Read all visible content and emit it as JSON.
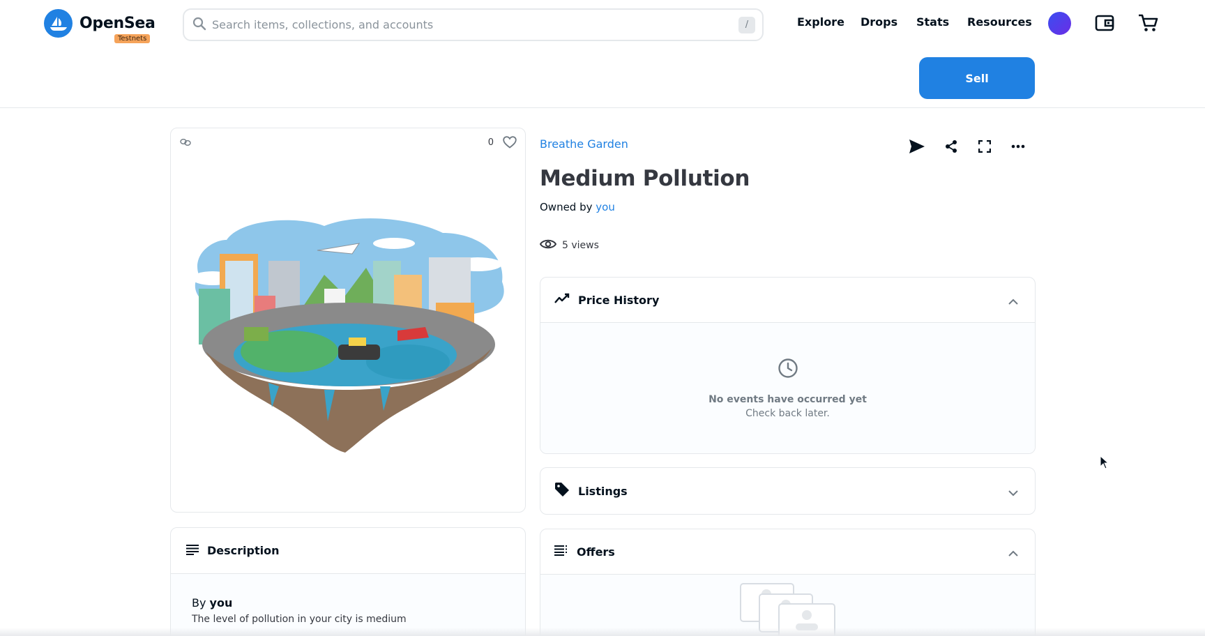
{
  "header": {
    "logo_text": "OpenSea",
    "badge": "Testnets",
    "search_placeholder": "Search items, collections, and accounts",
    "search_shortcut": "/",
    "nav": [
      "Explore",
      "Drops",
      "Stats",
      "Resources"
    ],
    "sell_label": "Sell"
  },
  "item": {
    "collection": "Breathe Garden",
    "title": "Medium Pollution",
    "owned_prefix": "Owned by",
    "owner": "you",
    "views": "5 views",
    "favorites": "0"
  },
  "description": {
    "title": "Description",
    "by_prefix": "By",
    "by_name": "you",
    "text": "The level of pollution in your city is medium"
  },
  "panels": {
    "price_history": {
      "title": "Price History",
      "empty_title": "No events have occurred yet",
      "empty_sub": "Check back later."
    },
    "listings": {
      "title": "Listings"
    },
    "offers": {
      "title": "Offers"
    }
  },
  "colors": {
    "accent": "#2081e2",
    "badge": "#f5a35a",
    "text": "#04111d"
  }
}
